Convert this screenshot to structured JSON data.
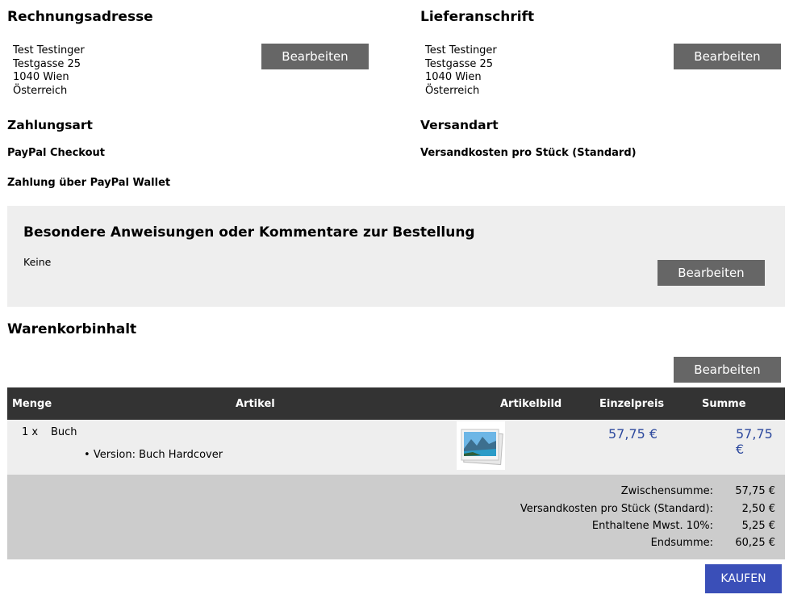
{
  "billing": {
    "title": "Rechnungsadresse",
    "lines": [
      "Test Testinger",
      "Testgasse 25",
      "1040 Wien",
      "Österreich"
    ],
    "edit_label": "Bearbeiten"
  },
  "shipping_address": {
    "title": "Lieferanschrift",
    "lines": [
      "Test Testinger",
      "Testgasse 25",
      "1040 Wien",
      "Österreich"
    ],
    "edit_label": "Bearbeiten"
  },
  "payment": {
    "title": "Zahlungsart",
    "method": "PayPal Checkout",
    "detail": "Zahlung über PayPal Wallet"
  },
  "shipping_method": {
    "title": "Versandart",
    "method": "Versandkosten pro Stück (Standard)"
  },
  "comments": {
    "title": "Besondere Anweisungen oder Kommentare zur Bestellung",
    "value": "Keine",
    "edit_label": "Bearbeiten"
  },
  "cart": {
    "title": "Warenkorbinhalt",
    "edit_label": "Bearbeiten",
    "columns": [
      "Menge",
      "Artikel",
      "Artikelbild",
      "Einzelpreis",
      "Summe"
    ],
    "items": [
      {
        "qty": "1 x",
        "name": "Buch",
        "attribute": "Version: Buch Hardcover",
        "unit_price": "57,75 €",
        "total": "57,75 €",
        "image_icon": "landscape-photo-icon"
      }
    ]
  },
  "totals": [
    {
      "label": "Zwischensumme:",
      "value": "57,75 €"
    },
    {
      "label": "Versandkosten pro Stück (Standard):",
      "value": "2,50 €"
    },
    {
      "label": "Enthaltene Mwst. 10%:",
      "value": "5,25 €"
    },
    {
      "label": "Endsumme:",
      "value": "60,25 €"
    }
  ],
  "buy_label": "KAUFEN",
  "colors": {
    "button_gray": "#666666",
    "header_dark": "#333333",
    "price_blue": "#2e4a9e",
    "buy_blue": "#3a4fb8"
  }
}
